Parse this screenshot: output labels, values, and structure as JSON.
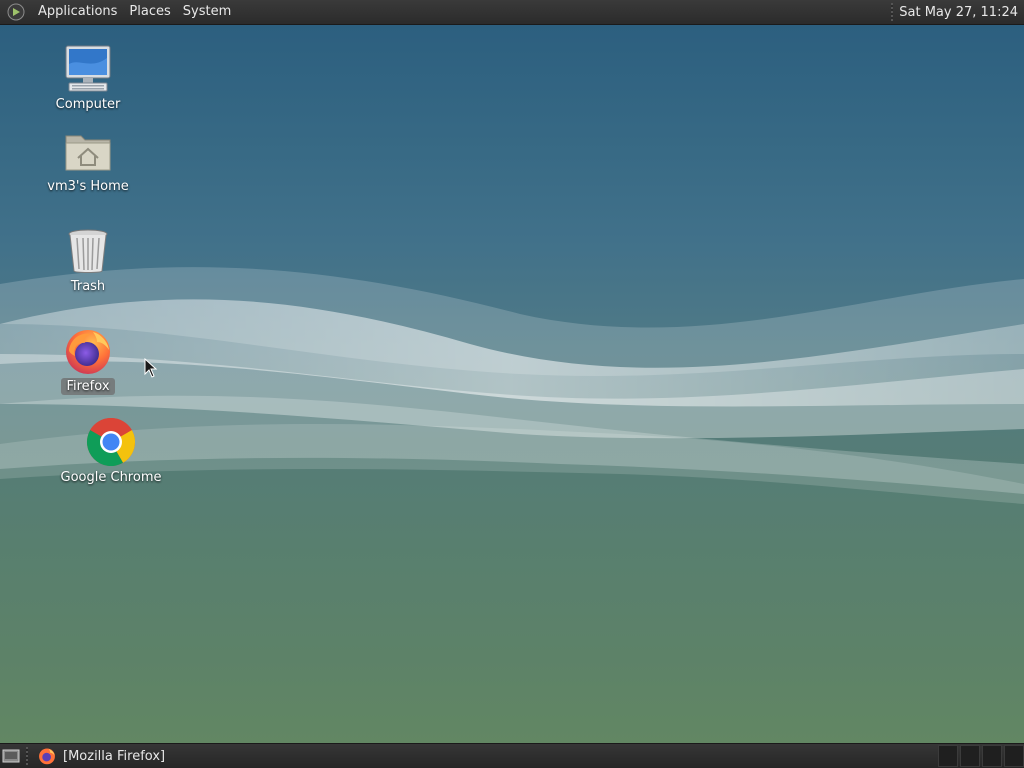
{
  "top_panel": {
    "menus": [
      "Applications",
      "Places",
      "System"
    ],
    "clock": "Sat May 27, 11:24"
  },
  "desktop": {
    "icons": [
      {
        "label": "Computer",
        "icon": "computer-icon"
      },
      {
        "label": "vm3's Home",
        "icon": "home-folder-icon"
      },
      {
        "label": "Trash",
        "icon": "trash-icon"
      },
      {
        "label": "Firefox",
        "icon": "firefox-icon",
        "selected": true
      },
      {
        "label": "Google Chrome",
        "icon": "chrome-icon"
      }
    ]
  },
  "bottom_panel": {
    "task_label": "[Mozilla Firefox]"
  },
  "colors": {
    "panel": "#2b2b2b",
    "wallpaper_top": "#2c5f7f",
    "wallpaper_bottom": "#628763"
  }
}
